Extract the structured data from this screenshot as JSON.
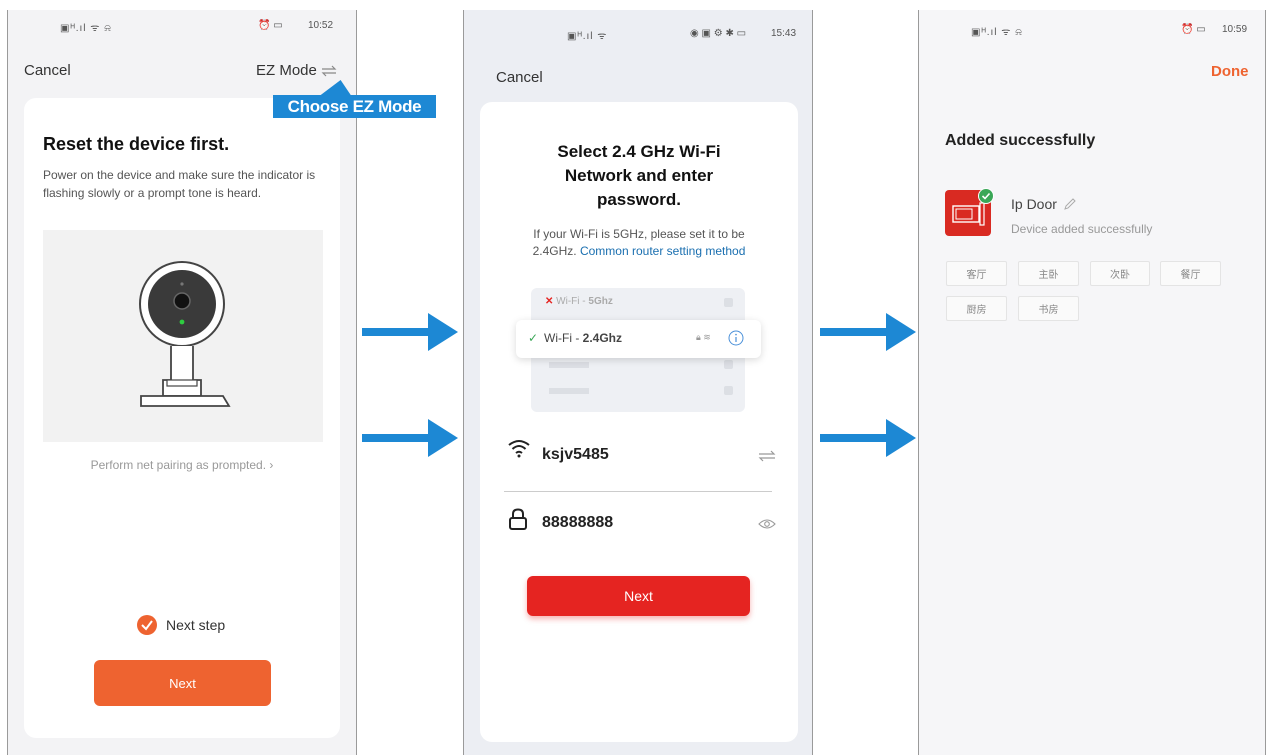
{
  "screen1": {
    "status_time": "10:52",
    "status_signal": "▣ᴴ.ıl ᯤ ⍾",
    "status_icons": "⏰ ▭",
    "cancel_label": "Cancel",
    "ez_mode_label": "EZ Mode",
    "callout_label": "Choose EZ Mode",
    "title": "Reset the device first.",
    "description": "Power on the device and make sure the indicator is flashing slowly or a prompt tone is heard.",
    "pairing_link": "Perform net pairing as prompted. ›",
    "next_step_label": "Next step",
    "next_button": "Next"
  },
  "screen2": {
    "status_time": "15:43",
    "status_signal": "▣ᴴ.ıl ᯤ",
    "status_icons": "◉ ▣ ⚙ ✱ ▭",
    "cancel_label": "Cancel",
    "title_line1": "Select 2.4 GHz Wi-Fi",
    "title_line2": "Network and enter",
    "title_line3": "password.",
    "hint_line1": "If your Wi-Fi is 5GHz, please set it to be",
    "hint_prefix": "2.4GHz.",
    "hint_link": "Common router setting method",
    "wifi_5g_prefix": "Wi-Fi - ",
    "wifi_5g_band": "5Ghz",
    "wifi_24_prefix": "Wi-Fi - ",
    "wifi_24_band": "2.4Ghz",
    "ssid": "ksjv5485",
    "password": "88888888",
    "next_button": "Next"
  },
  "screen3": {
    "status_time": "10:59",
    "status_signal": "▣ᴴ.ıl ᯤ ⍾",
    "status_icons": "⏰ ▭",
    "done_label": "Done",
    "title": "Added successfully",
    "device_name": "Ip Door",
    "device_status": "Device added successfully",
    "rooms": [
      "客厅",
      "主卧",
      "次卧",
      "餐厅",
      "厨房",
      "书房"
    ]
  },
  "colors": {
    "orange": "#ee6330",
    "red": "#e52421",
    "blue_arrow": "#1d88d4",
    "link_blue": "#1a6fb0",
    "check_green": "#3aa757"
  }
}
